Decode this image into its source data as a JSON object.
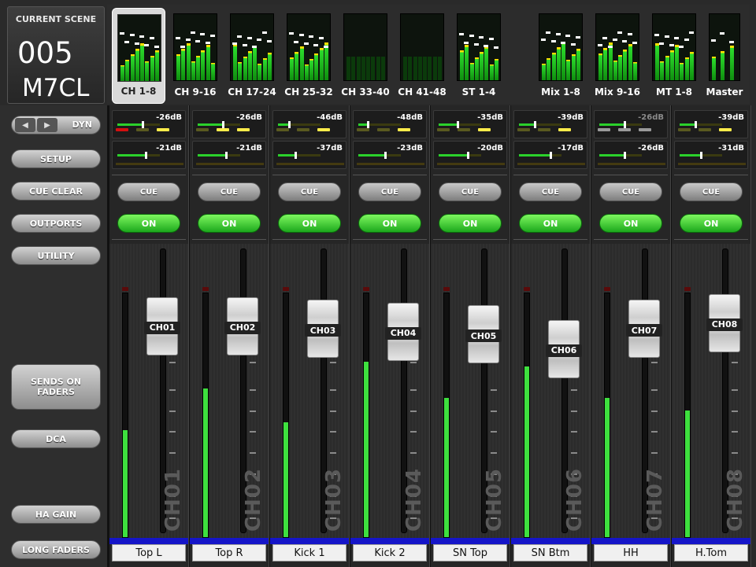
{
  "scene": {
    "label": "CURRENT SCENE",
    "number": "005",
    "name": "M7CL"
  },
  "overview": {
    "banks": [
      {
        "label": "CH 1-8",
        "selected": true
      },
      {
        "label": "CH 9-16"
      },
      {
        "label": "CH 17-24"
      },
      {
        "label": "CH 25-32"
      },
      {
        "label": "CH 33-40"
      },
      {
        "label": "CH 41-48"
      },
      {
        "label": "ST 1-4"
      },
      {
        "label": "Mix 1-8"
      },
      {
        "label": "Mix 9-16"
      },
      {
        "label": "MT 1-8"
      },
      {
        "label": "Master"
      }
    ]
  },
  "nav": {
    "dyn_label": "DYN",
    "prev_icon": "triangle-left-icon",
    "next_icon": "triangle-right-icon"
  },
  "left_buttons": {
    "setup": "SETUP",
    "cue_clear": "CUE CLEAR",
    "outports": "OUTPORTS",
    "utility": "UTILITY",
    "sends_on_faders": "SENDS ON FADERS",
    "dca": "DCA",
    "ha_gain": "HA GAIN",
    "long_faders": "LONG FADERS"
  },
  "channels": [
    {
      "id": "CH01",
      "name": "Top L",
      "send1": "-26dB",
      "send2": "-21dB",
      "cue": "CUE",
      "on": "ON",
      "fader": 0.83,
      "meter": 0.44
    },
    {
      "id": "CH02",
      "name": "Top R",
      "send1": "-26dB",
      "send2": "-21dB",
      "cue": "CUE",
      "on": "ON",
      "fader": 0.83,
      "meter": 0.61
    },
    {
      "id": "CH03",
      "name": "Kick 1",
      "send1": "-46dB",
      "send2": "-37dB",
      "cue": "CUE",
      "on": "ON",
      "fader": 0.82,
      "meter": 0.47
    },
    {
      "id": "CH04",
      "name": "Kick 2",
      "send1": "-48dB",
      "send2": "-23dB",
      "cue": "CUE",
      "on": "ON",
      "fader": 0.81,
      "meter": 0.72
    },
    {
      "id": "CH05",
      "name": "SN Top",
      "send1": "-35dB",
      "send2": "-20dB",
      "cue": "CUE",
      "on": "ON",
      "fader": 0.8,
      "meter": 0.57
    },
    {
      "id": "CH06",
      "name": "SN Btm",
      "send1": "-39dB",
      "send2": "-17dB",
      "cue": "CUE",
      "on": "ON",
      "fader": 0.75,
      "meter": 0.7
    },
    {
      "id": "CH07",
      "name": "HH",
      "send1": "-26dB",
      "send2": "-26dB",
      "cue": "CUE",
      "on": "ON",
      "fader": 0.82,
      "meter": 0.57,
      "send1_dim": true
    },
    {
      "id": "CH08",
      "name": "H.Tom",
      "send1": "-39dB",
      "send2": "-31dB",
      "cue": "CUE",
      "on": "ON",
      "fader": 0.84,
      "meter": 0.52
    }
  ],
  "colors": {
    "accent_green": "#2bd12b",
    "on_green": "#4fd33c",
    "name_bar": "#1515c8"
  }
}
